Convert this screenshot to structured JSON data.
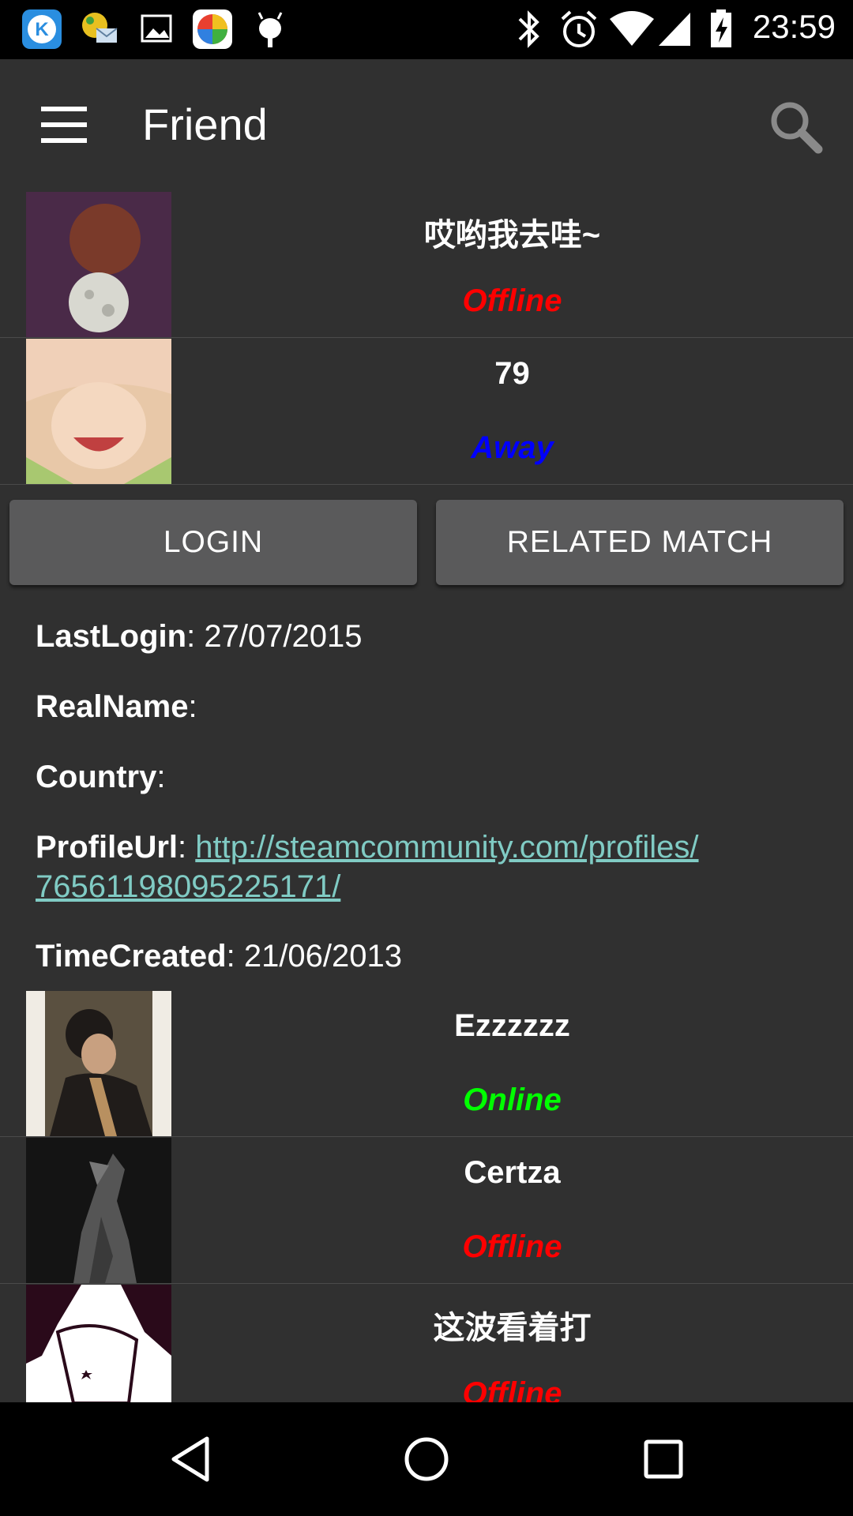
{
  "status_bar": {
    "time": "23:59",
    "app_icons": [
      "k-app-icon",
      "mail-app-icon",
      "image-icon",
      "pinwheel-app-icon",
      "android-debug-icon"
    ],
    "right_icons": [
      "bluetooth-icon",
      "alarm-icon",
      "wifi-icon",
      "signal-icon",
      "battery-charging-icon"
    ]
  },
  "app_bar": {
    "title": "Friend"
  },
  "friends_top": [
    {
      "name": "哎哟我去哇~",
      "status": "Offline",
      "status_color": "#ff0000"
    },
    {
      "name": "79",
      "status": "Away",
      "status_color": "#0000ff"
    }
  ],
  "buttons": {
    "login": "LOGIN",
    "related_match": "RELATED MATCH"
  },
  "details": {
    "last_login_label": "LastLogin",
    "last_login_value": "27/07/2015",
    "real_name_label": "RealName",
    "real_name_value": "",
    "country_label": "Country",
    "country_value": "",
    "profile_url_label": "ProfileUrl",
    "profile_url_line1": "http://steamcommunity.com/profiles/",
    "profile_url_line2": "76561198095225171/",
    "time_created_label": "TimeCreated",
    "time_created_value": "21/06/2013"
  },
  "friends_bottom": [
    {
      "name": "Ezzzzzz",
      "status": "Online",
      "status_color": "#00ff00"
    },
    {
      "name": "Certza",
      "status": "Offline",
      "status_color": "#ff0000"
    },
    {
      "name": "这波看着打",
      "status": "Offline",
      "status_color": "#ff0000"
    }
  ],
  "nav_bar": {
    "icons": [
      "back-icon",
      "home-icon",
      "recents-icon"
    ]
  }
}
